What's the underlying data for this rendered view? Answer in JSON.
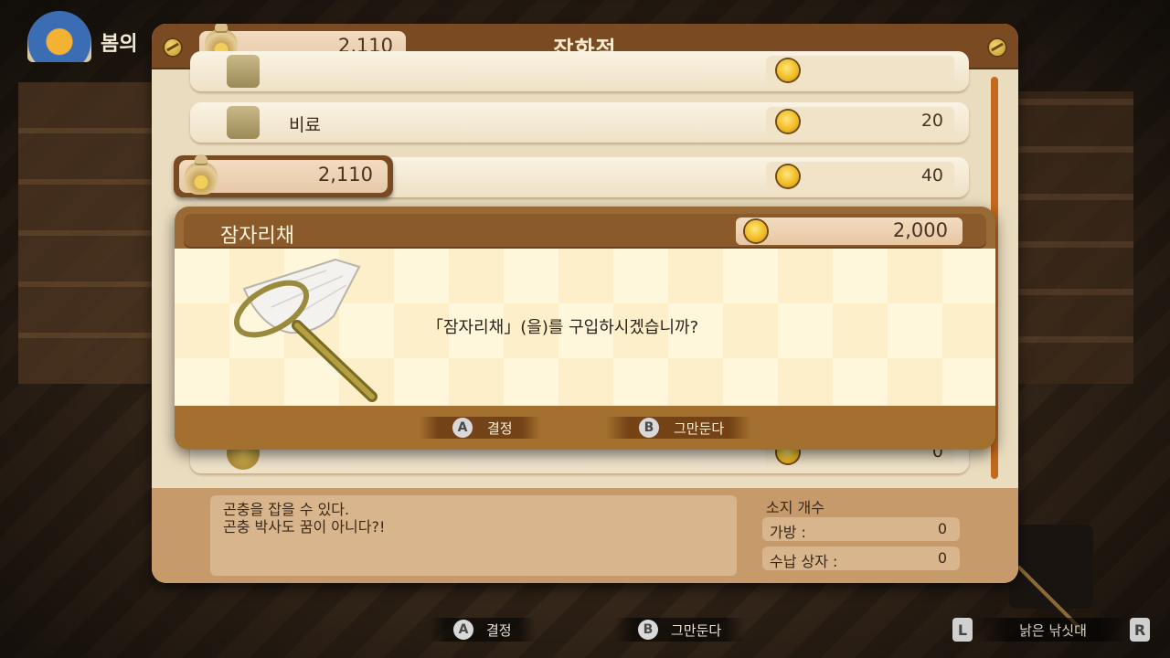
{
  "hud": {
    "season_text": "봄의",
    "money": "2,110"
  },
  "shop": {
    "title": "잡화점",
    "items": [
      {
        "name": "",
        "price": ""
      },
      {
        "name": "비료",
        "price": "20"
      },
      {
        "name": "",
        "price": "40"
      },
      {
        "name": "",
        "price": "0"
      }
    ],
    "selected_money": "2,110",
    "description_line1": "곤충을 잡을 수 있다.",
    "description_line2": "곤충 박사도 꿈이 아니다?!",
    "owned_title": "소지 개수",
    "bag_label": "가방 :",
    "bag_value": "0",
    "storage_label": "수납 상자 :",
    "storage_value": "0"
  },
  "dialog": {
    "item_name": "잠자리채",
    "price": "2,000",
    "question": "「잠자리채」(을)를 구입하시겠습니까?",
    "confirm_button": "A",
    "confirm_label": "결정",
    "cancel_button": "B",
    "cancel_label": "그만둔다"
  },
  "bottom": {
    "confirm_button": "A",
    "confirm_label": "결정",
    "cancel_button": "B",
    "cancel_label": "그만둔다",
    "l_button": "L",
    "r_button": "R",
    "tool_name": "낡은 낚싯대"
  },
  "icons": {
    "currency": "coin-icon",
    "wallet": "money-bag-icon",
    "tool": "fishing-rod-icon",
    "item": "bug-net-icon"
  },
  "colors": {
    "header_brown": "#7a4b22",
    "coin_gold": "#f0b820",
    "cream": "#fff7dc"
  }
}
